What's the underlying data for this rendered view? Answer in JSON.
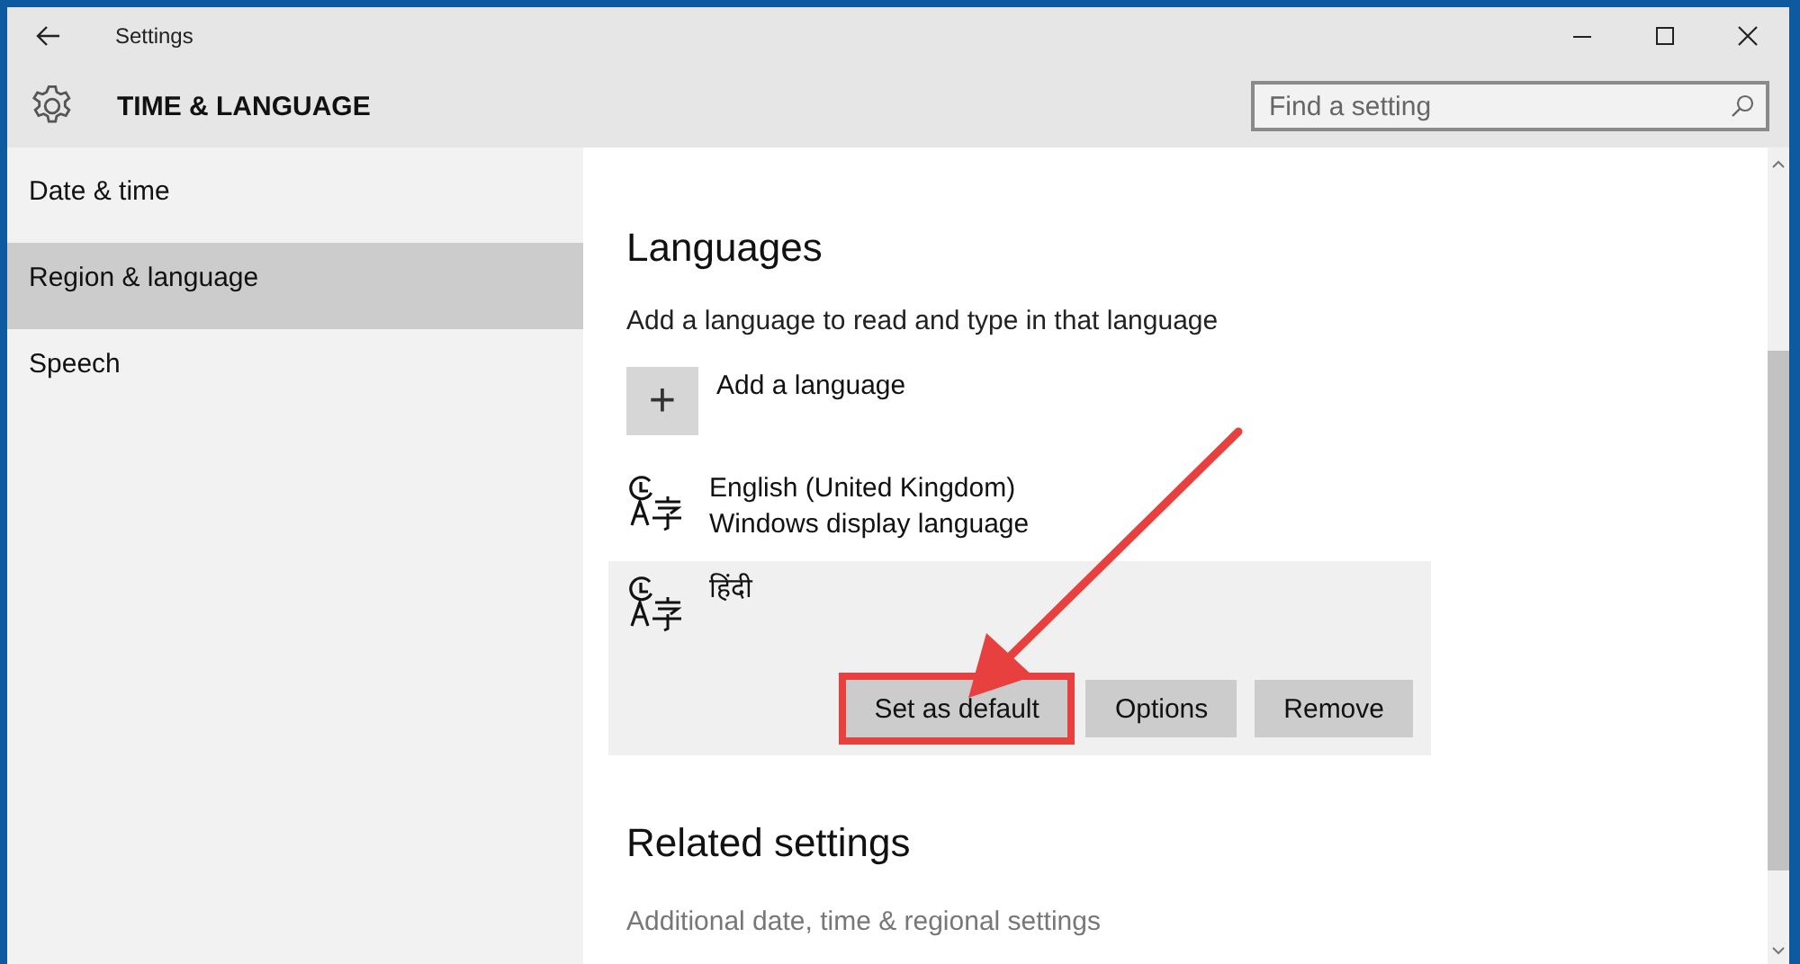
{
  "window": {
    "title": "Settings"
  },
  "header": {
    "title": "TIME & LANGUAGE",
    "search": {
      "placeholder": "Find a setting"
    }
  },
  "sidebar": {
    "items": [
      {
        "label": "Date & time",
        "selected": false
      },
      {
        "label": "Region & language",
        "selected": true
      },
      {
        "label": "Speech",
        "selected": false
      }
    ]
  },
  "content": {
    "heading": "Languages",
    "description": "Add a language to read and type in that language",
    "add_button": {
      "icon": "+",
      "label": "Add a language"
    },
    "languages": [
      {
        "name": "English (United Kingdom)",
        "detail": "Windows display language",
        "selected": false
      },
      {
        "name": "हिंदी",
        "selected": true,
        "buttons": [
          {
            "label": "Set as default",
            "highlighted": true
          },
          {
            "label": "Options",
            "highlighted": false
          },
          {
            "label": "Remove",
            "highlighted": false
          }
        ]
      }
    ],
    "related_heading": "Related settings",
    "related_link": "Additional date, time & regional settings"
  },
  "annotation_arrow": true
}
